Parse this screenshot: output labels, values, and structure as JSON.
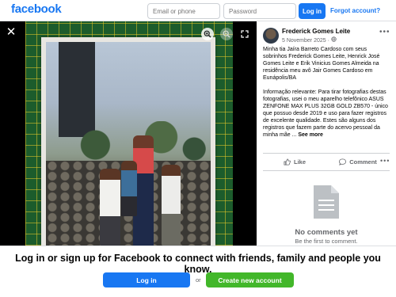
{
  "header": {
    "logo_text": "facebook",
    "email_placeholder": "Email or phone",
    "password_placeholder": "Password",
    "login_label": "Log in",
    "forgot_label": "Forgot account?"
  },
  "viewer": {
    "close_icon": "close-icon",
    "zoom_in_icon": "zoom-in-icon",
    "zoom_out_icon": "zoom-out-icon",
    "expand_icon": "expand-icon"
  },
  "post": {
    "author": "Frederick Gomes Leite",
    "date": "5 November 2025",
    "separator": " · ",
    "caption": "Minha tia Jaíra Barreto Cardoso com seus sobrinhos Frederick Gomes Leite, Henrick José Gomes Leite e Erik Vinicius Gomes Almeida na residência meu avô Jair Gomes Cardoso em Eunápolis/BA\n\nInformação relevante: Para tirar fotografias destas fotografias, usei o meu aparelho telefônico ASUS ZENFONE MAX PLUS 32GB GOLD ZB570 - único que possuo desde 2019 e uso para fazer registros de excelente qualidade. Estes são alguns dos registros que fazem parte do acervo pessoal da minha mãe ...",
    "see_more": "See more",
    "like_label": "Like",
    "comment_label": "Comment",
    "no_comments_title": "No comments yet",
    "no_comments_sub": "Be the first to comment."
  },
  "banner": {
    "text": "Log in or sign up for Facebook to connect with friends, family and people you know.",
    "login_label": "Log in",
    "or_label": "or",
    "create_label": "Create new account"
  },
  "colors": {
    "brand": "#1877f2",
    "create": "#42b72a",
    "muted": "#65676b"
  }
}
